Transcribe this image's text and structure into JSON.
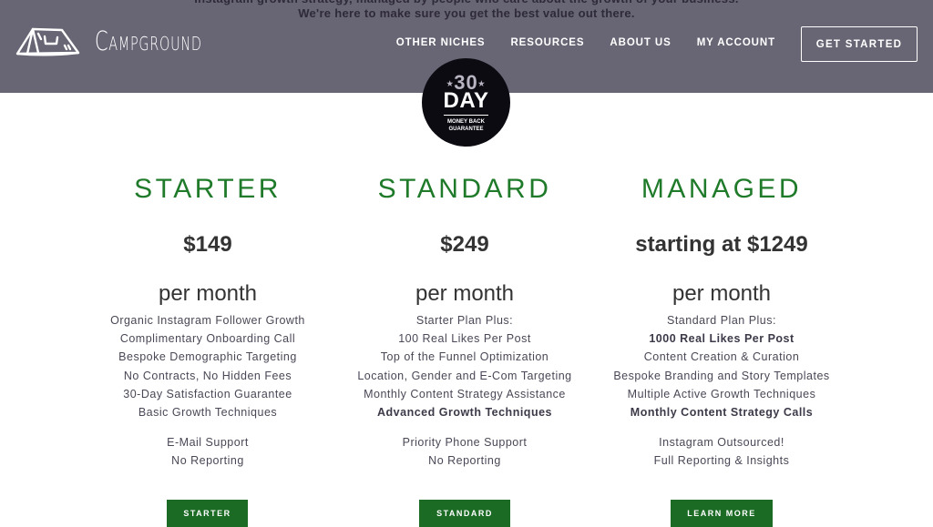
{
  "header": {
    "announcement_line1": "Instagram growth strategy, managed by people who care about the growth of your business.",
    "announcement_line2": "We're here to make sure you get the best value out there.",
    "brand": "Campground",
    "logo_icon": "tent-icon",
    "nav": [
      {
        "label": "OTHER NICHES"
      },
      {
        "label": "RESOURCES"
      },
      {
        "label": "ABOUT US"
      },
      {
        "label": "MY ACCOUNT"
      }
    ],
    "cta_label": "GET STARTED",
    "bg_color": "#686574"
  },
  "badge": {
    "number": "30",
    "unit": "DAY",
    "line1": "MONEY BACK",
    "line2": "GUARANTEE"
  },
  "accent_color": "#1f7a2a",
  "plans": [
    {
      "name": "STARTER",
      "price": "$149",
      "period": "per month",
      "features": [
        {
          "text": "Organic Instagram Follower Growth",
          "bold": false
        },
        {
          "text": "Complimentary Onboarding Call",
          "bold": false
        },
        {
          "text": "Bespoke Demographic Targeting",
          "bold": false
        },
        {
          "text": "No Contracts, No Hidden Fees",
          "bold": false
        },
        {
          "text": "30-Day Satisfaction Guarantee",
          "bold": false
        },
        {
          "text": "Basic Growth Techniques",
          "bold": false
        }
      ],
      "support": [
        "E-Mail Support",
        "No Reporting"
      ],
      "button": "STARTER"
    },
    {
      "name": "STANDARD",
      "price": "$249",
      "period": "per month",
      "features": [
        {
          "text": "Starter Plan Plus:",
          "bold": false
        },
        {
          "text": "100 Real Likes Per Post",
          "bold": false
        },
        {
          "text": "Top of the Funnel Optimization",
          "bold": false
        },
        {
          "text": "Location, Gender and E-Com Targeting",
          "bold": false
        },
        {
          "text": "Monthly Content Strategy Assistance",
          "bold": false
        },
        {
          "text": "Advanced Growth Techniques",
          "bold": true
        }
      ],
      "support": [
        "Priority Phone Support",
        "No Reporting"
      ],
      "button": "STANDARD"
    },
    {
      "name": "MANAGED",
      "price": "starting at $1249",
      "period": "per month",
      "features": [
        {
          "text": "Standard Plan Plus:",
          "bold": false
        },
        {
          "text": "1000 Real Likes Per Post",
          "bold": true
        },
        {
          "text": "Content Creation & Curation",
          "bold": false
        },
        {
          "text": "Bespoke Branding and Story Templates",
          "bold": false
        },
        {
          "text": "Multiple Active Growth Techniques",
          "bold": false
        },
        {
          "text": "Monthly Content Strategy Calls",
          "bold": true
        }
      ],
      "support": [
        "Instagram Outsourced!",
        "Full Reporting & Insights"
      ],
      "button": "LEARN MORE"
    }
  ]
}
